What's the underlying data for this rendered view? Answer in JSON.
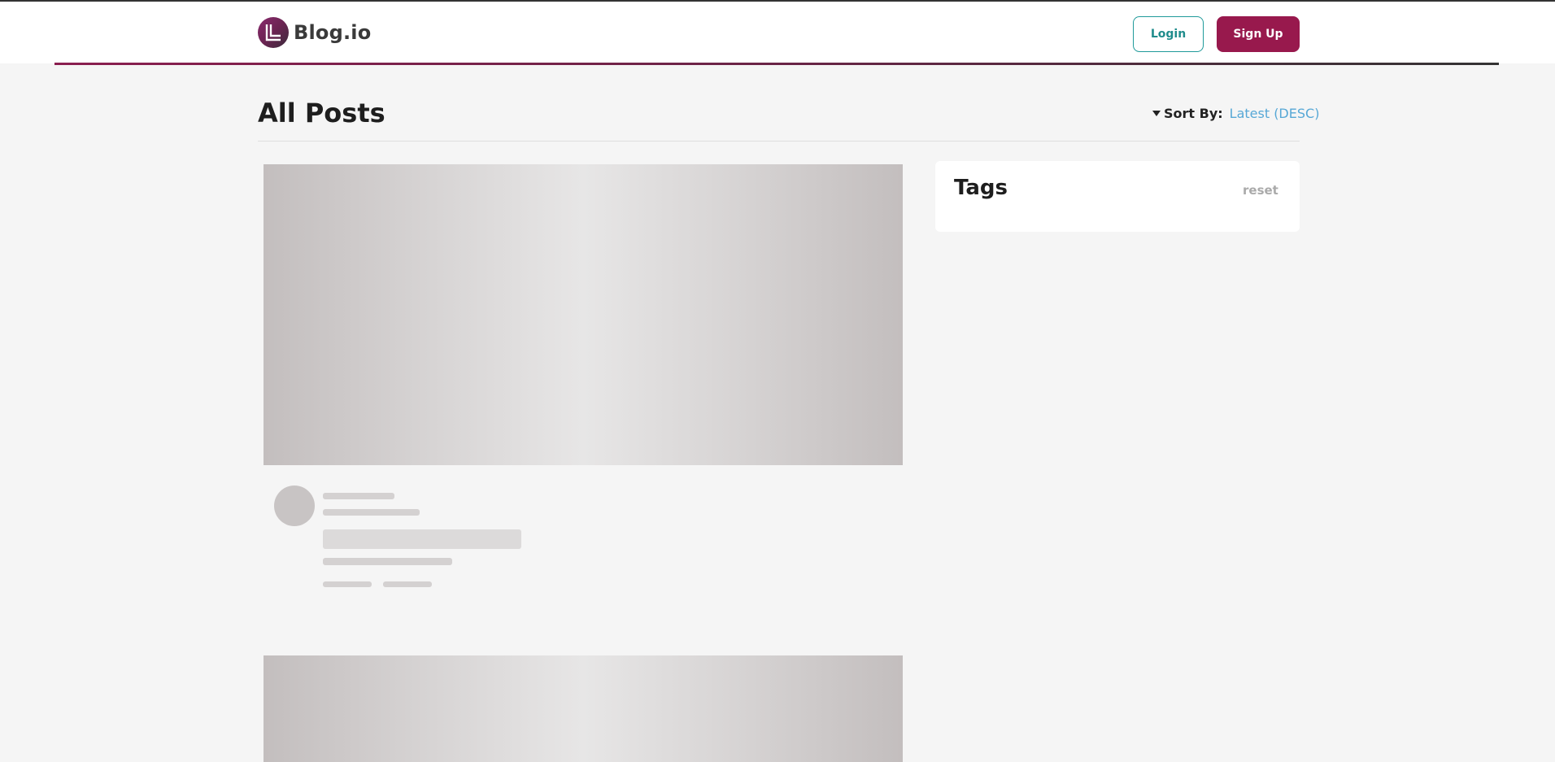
{
  "brand": {
    "name": "Blog.io",
    "primary_color": "#98194d",
    "accent_color": "#1f9a9a",
    "link_color": "#57a8d6"
  },
  "header": {
    "login_label": "Login",
    "signup_label": "Sign Up"
  },
  "main": {
    "title": "All Posts",
    "sort": {
      "label": "Sort By:",
      "value": "Latest (DESC)",
      "icon": "caret-down-icon"
    }
  },
  "sidebar": {
    "tags_title": "Tags",
    "reset_label": "reset"
  },
  "posts": [
    {
      "state": "loading"
    },
    {
      "state": "loading"
    }
  ]
}
